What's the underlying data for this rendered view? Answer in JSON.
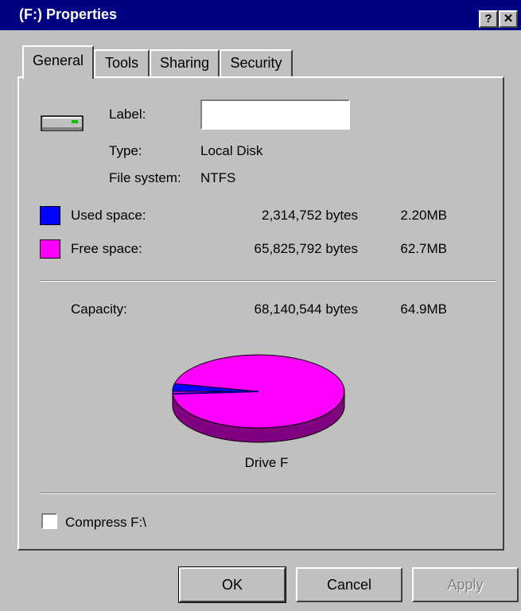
{
  "window": {
    "title": "(F:) Properties",
    "help_button": "?",
    "close_button": "✕"
  },
  "tabs": [
    {
      "label": "General"
    },
    {
      "label": "Tools"
    },
    {
      "label": "Sharing"
    },
    {
      "label": "Security"
    }
  ],
  "general": {
    "label_label": "Label:",
    "label_value": "",
    "type_label": "Type:",
    "type_value": "Local Disk",
    "fs_label": "File system:",
    "fs_value": "NTFS",
    "used_label": "Used space:",
    "used_bytes": "2,314,752 bytes",
    "used_size": "2.20MB",
    "free_label": "Free space:",
    "free_bytes": "65,825,792 bytes",
    "free_size": "62.7MB",
    "capacity_label": "Capacity:",
    "capacity_bytes": "68,140,544 bytes",
    "capacity_size": "64.9MB",
    "drive_label": "Drive F",
    "compress_label": "Compress F:\\",
    "compress_checked": false
  },
  "colors": {
    "used": "#0000ff",
    "free": "#ff00ff",
    "free_side": "#800080",
    "used_side": "#000080"
  },
  "buttons": {
    "ok": "OK",
    "cancel": "Cancel",
    "apply": "Apply"
  },
  "chart_data": {
    "type": "pie",
    "categories": [
      "Used space",
      "Free space"
    ],
    "values": [
      2314752,
      65825792
    ],
    "title": "Drive F"
  }
}
